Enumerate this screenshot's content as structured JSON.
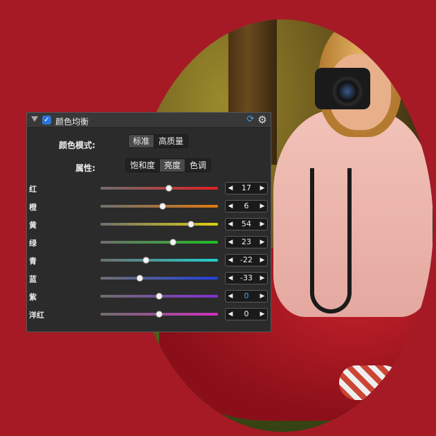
{
  "panel": {
    "title": "颜色均衡",
    "enabled": true,
    "check_glyph": "✓",
    "reset_icon_glyph": "⟳",
    "gear_icon_glyph": "⚙"
  },
  "color_mode": {
    "label": "颜色模式:",
    "options": [
      "标准",
      "高质量"
    ],
    "selected": "标准"
  },
  "attribute": {
    "label": "属性:",
    "options": [
      "饱和度",
      "亮度",
      "色调"
    ],
    "selected": "亮度"
  },
  "channels": [
    {
      "label": "红",
      "value": "17",
      "level": 17,
      "color_from": "#6e6e6e",
      "color_to": "#e02020"
    },
    {
      "label": "橙",
      "value": "6",
      "level": 6,
      "color_from": "#6e6e6e",
      "color_to": "#e07a10"
    },
    {
      "label": "黄",
      "value": "54",
      "level": 54,
      "color_from": "#6e6e6e",
      "color_to": "#e0d010"
    },
    {
      "label": "绿",
      "value": "23",
      "level": 23,
      "color_from": "#6e6e6e",
      "color_to": "#20c020"
    },
    {
      "label": "青",
      "value": "-22",
      "level": -22,
      "color_from": "#6e6e6e",
      "color_to": "#20d0d0"
    },
    {
      "label": "蓝",
      "value": "-33",
      "level": -33,
      "color_from": "#6e6e6e",
      "color_to": "#2040e0"
    },
    {
      "label": "紫",
      "value": "0",
      "level": 0,
      "color_from": "#6e6e6e",
      "color_to": "#8030d0",
      "focused": true
    },
    {
      "label": "洋红",
      "value": "0",
      "level": 0,
      "color_from": "#6e6e6e",
      "color_to": "#d030c0"
    }
  ],
  "slider_range": [
    -100,
    100
  ],
  "stepper_glyphs": {
    "dec": "◀",
    "inc": "▶"
  }
}
